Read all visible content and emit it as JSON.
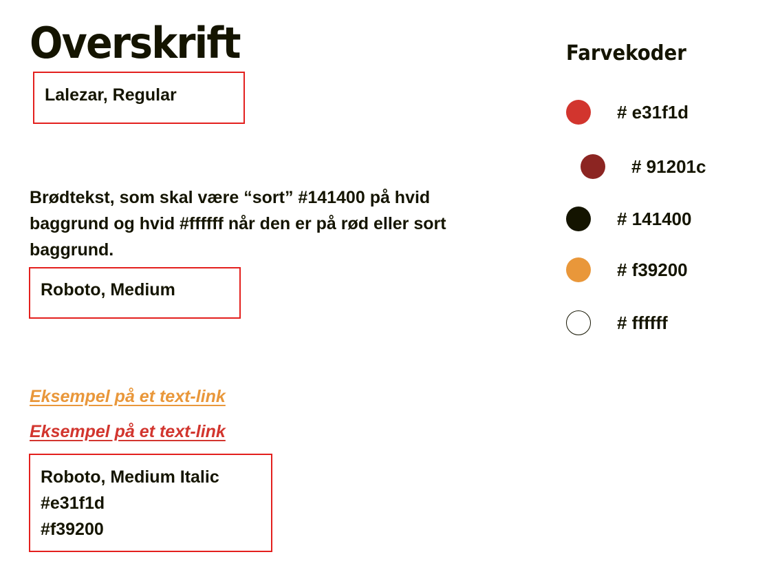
{
  "heading": {
    "title": "Overskrift",
    "font_spec": "Lalezar, Regular"
  },
  "body": {
    "text": "Brødtekst, som skal være “sort” #141400 på hvid baggrund og hvid #ffffff når den er på rød eller sort baggrund.",
    "font_spec": "Roboto, Medium"
  },
  "links": {
    "items": [
      {
        "label": "Eksempel på et text-link",
        "color": "#e9973a"
      },
      {
        "label": "Eksempel på et text-link",
        "color": "#d2352e"
      }
    ],
    "font_spec_lines": [
      "Roboto, Medium Italic",
      "#e31f1d",
      "#f39200"
    ]
  },
  "colors": {
    "title": "Farvekoder",
    "swatches": [
      {
        "label": "# e31f1d",
        "hex": "#d2352e"
      },
      {
        "label": "# 91201c",
        "hex": "#8c2522"
      },
      {
        "label": "# 141400",
        "hex": "#141400"
      },
      {
        "label": "# f39200",
        "hex": "#e9973a"
      },
      {
        "label": "# ffffff",
        "hex": "#ffffff"
      }
    ]
  },
  "accent_colors": {
    "box_border": "#e31f1d",
    "text": "#141400"
  }
}
